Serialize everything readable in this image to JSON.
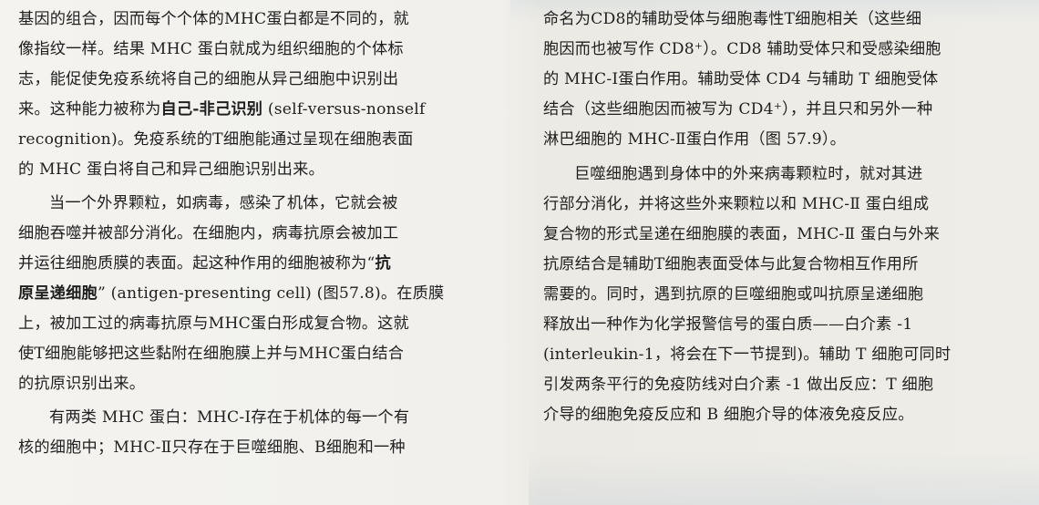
{
  "left_column": [
    "基因的组合，因而每个个体的MHC蛋白都是不同的，就",
    "像指纹一样。结果 MHC 蛋白就成为组织细胞的个体标",
    "志，能促使免疫系统将自己的细胞从异己细胞中识别出",
    [
      "来。这种能力被称为",
      "自己-非己识别",
      " (self-versus-nonself"
    ],
    "recognition)。免疫系统的T细胞能通过呈现在细胞表面",
    "的 MHC 蛋白将自己和异己细胞识别出来。",
    "当一个外界颗粒，如病毒，感染了机体，它就会被",
    "细胞吞噬并被部分消化。在细胞内，病毒抗原会被加工",
    [
      "并运往细胞质膜的表面。起这种作用的细胞被称为“",
      "抗",
      ""
    ],
    [
      "",
      "原呈递细胞",
      "” (antigen-presenting cell) (图57.8)。在质膜"
    ],
    "上，被加工过的病毒抗原与MHC蛋白形成复合物。这就",
    "使T细胞能够把这些黏附在细胞膜上并与MHC蛋白结合",
    "的抗原识别出来。",
    "有两类 MHC 蛋白：MHC-Ⅰ存在于机体的每一个有",
    "核的细胞中；MHC-Ⅱ只存在于巨噬细胞、B细胞和一种"
  ],
  "right_column": [
    "命名为CD8的辅助受体与细胞毒性T细胞相关（这些细",
    "胞因而也被写作 CD8⁺）。CD8 辅助受体只和受感染细胞",
    "的 MHC-Ⅰ蛋白作用。辅助受体 CD4 与辅助 T 细胞受体",
    "结合（这些细胞因而被写为 CD4⁺），并且只和另外一种",
    "淋巴细胞的 MHC-Ⅱ蛋白作用（图 57.9）。",
    "巨噬细胞遇到身体中的外来病毒颗粒时，就对其进",
    "行部分消化，并将这些外来颗粒以和 MHC-Ⅱ 蛋白组成",
    "复合物的形式呈递在细胞膜的表面，MHC-Ⅱ 蛋白与外来",
    "抗原结合是辅助T细胞表面受体与此复合物相互作用所",
    "需要的。同时，遇到抗原的巨噬细胞或叫抗原呈递细胞",
    "释放出一种作为化学报警信号的蛋白质——白介素 -1",
    "(interleukin-1，将会在下一节提到)。辅助 T 细胞可同时",
    "引发两条平行的免疫防线对白介素 -1 做出反应：T 细胞",
    "介导的细胞免疫反应和 B 细胞介导的体液免疫反应。"
  ]
}
